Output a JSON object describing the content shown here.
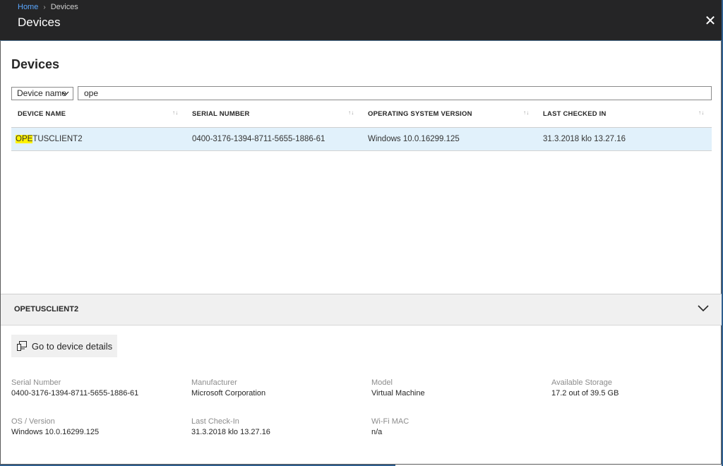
{
  "breadcrumb": {
    "home": "Home",
    "separator": "›",
    "current": "Devices"
  },
  "blade": {
    "title": "Devices",
    "close_glyph": "✕"
  },
  "page": {
    "heading": "Devices"
  },
  "filter": {
    "field_label": "Device name",
    "search_value": "ope"
  },
  "table": {
    "columns": [
      "DEVICE NAME",
      "SERIAL NUMBER",
      "OPERATING SYSTEM VERSION",
      "LAST CHECKED IN"
    ],
    "sort_glyph": "↑↓",
    "rows": [
      {
        "name_match": "OPE",
        "name_rest": "TUSCLIENT2",
        "serial": "0400-3176-1394-8711-5655-1886-61",
        "os": "Windows 10.0.16299.125",
        "last_checked": "31.3.2018 klo 13.27.16"
      }
    ]
  },
  "details": {
    "device_name": "OPETUSCLIENT2",
    "go_button": "Go to device details",
    "fields": {
      "serial_number": {
        "label": "Serial Number",
        "value": "0400-3176-1394-8711-5655-1886-61"
      },
      "manufacturer": {
        "label": "Manufacturer",
        "value": "Microsoft Corporation"
      },
      "model": {
        "label": "Model",
        "value": "Virtual Machine"
      },
      "available_storage": {
        "label": "Available Storage",
        "value": "17.2 out of 39.5 GB"
      },
      "os_version": {
        "label": "OS / Version",
        "value": "Windows 10.0.16299.125"
      },
      "last_checkin": {
        "label": "Last Check-In",
        "value": "31.3.2018 klo 13.27.16"
      },
      "wifi_mac": {
        "label": "Wi-Fi MAC",
        "value": "n/a"
      }
    }
  },
  "colors": {
    "accent": "#5aa7ff",
    "selected_row": "#e1f1fb",
    "highlight": "#fff200",
    "topbar": "#252526"
  }
}
